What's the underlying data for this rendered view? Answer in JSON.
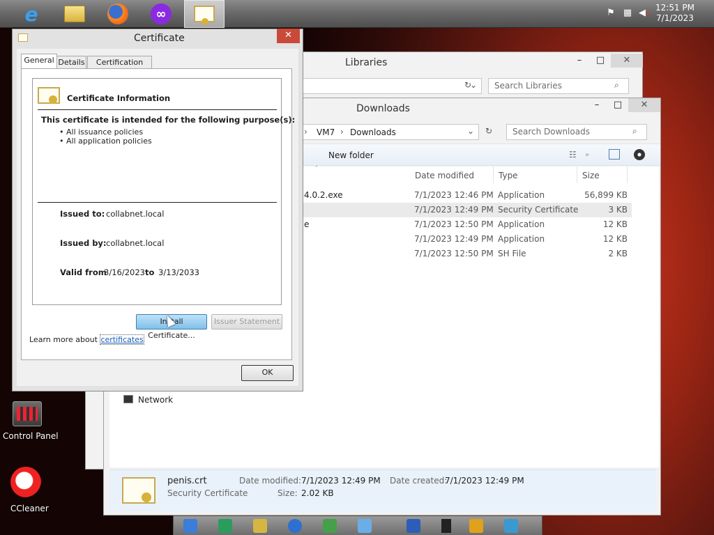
{
  "taskbar": {
    "apps": [
      {
        "name": "internet-explorer",
        "glyph": "e"
      },
      {
        "name": "file-explorer",
        "glyph": ""
      },
      {
        "name": "firefox",
        "glyph": ""
      },
      {
        "name": "app-purple",
        "glyph": "∞"
      },
      {
        "name": "certificate",
        "glyph": ""
      }
    ],
    "clock_time": "12:51 PM",
    "clock_date": "7/1/2023"
  },
  "desktop": {
    "control_panel": "Control Panel",
    "ccleaner": "CCleaner"
  },
  "libraries_window": {
    "title": "Libraries",
    "search_placeholder": "Search Libraries"
  },
  "downloads_window": {
    "title": "Downloads",
    "breadcrumb": [
      "VM7",
      "Downloads"
    ],
    "search_placeholder": "Search Downloads",
    "new_folder": "New folder",
    "columns": {
      "date": "Date modified",
      "type": "Type",
      "size": "Size"
    },
    "rows": [
      {
        "name": "4.0.2.exe",
        "date": "7/1/2023 12:46 PM",
        "type": "Application",
        "size": "56,899 KB"
      },
      {
        "name": "",
        "date": "7/1/2023 12:49 PM",
        "type": "Security Certificate",
        "size": "3 KB"
      },
      {
        "name": "e",
        "date": "7/1/2023 12:50 PM",
        "type": "Application",
        "size": "12 KB"
      },
      {
        "name": "",
        "date": "7/1/2023 12:49 PM",
        "type": "Application",
        "size": "12 KB"
      },
      {
        "name": "",
        "date": "7/1/2023 12:50 PM",
        "type": "SH File",
        "size": "2 KB"
      }
    ],
    "nav_network": "Network",
    "details": {
      "filename": "penis.crt",
      "filetype": "Security Certificate",
      "date_modified_label": "Date modified:",
      "date_modified": "7/1/2023 12:49 PM",
      "date_created_label": "Date created:",
      "date_created": "7/1/2023 12:49 PM",
      "size_label": "Size:",
      "size": "2.02 KB"
    }
  },
  "certificate_dialog": {
    "title": "Certificate",
    "tabs": [
      "General",
      "Details",
      "Certification Path"
    ],
    "info_heading": "Certificate Information",
    "purpose_heading": "This certificate is intended for the following purpose(s):",
    "purposes": [
      "• All issuance policies",
      "• All application policies"
    ],
    "issued_to_label": "Issued to:",
    "issued_to": "collabnet.local",
    "issued_by_label": "Issued by:",
    "issued_by": "collabnet.local",
    "valid_from_label": "Valid from",
    "valid_from": "3/16/2023",
    "valid_to_label": "to",
    "valid_to": "3/13/2033",
    "install_button": "Install Certificate...",
    "issuer_statement_button": "Issuer Statement",
    "learn_more_prefix": "Learn more about",
    "learn_more_link": "certificates",
    "ok_button": "OK"
  }
}
